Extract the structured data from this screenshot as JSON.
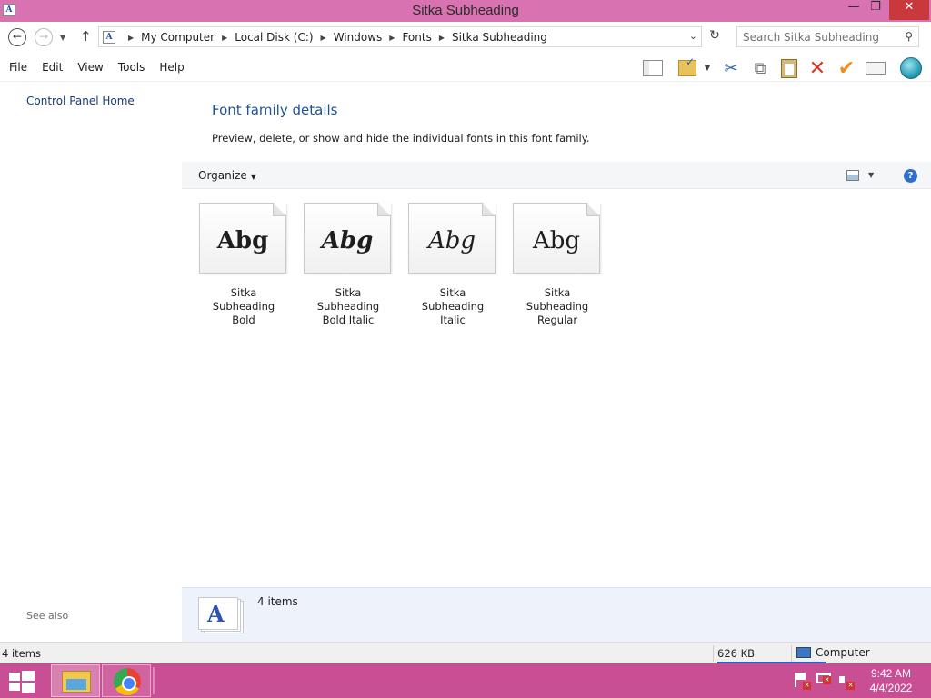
{
  "window": {
    "title": "Sitka Subheading",
    "minimize_glyph": "—",
    "maximize_glyph": "❐",
    "close_glyph": "✕"
  },
  "address": {
    "crumbs": [
      "My Computer",
      "Local Disk (C:)",
      "Windows",
      "Fonts",
      "Sitka Subheading"
    ],
    "search_placeholder": "Search Sitka Subheading"
  },
  "menu": {
    "items": [
      "File",
      "Edit",
      "View",
      "Tools",
      "Help"
    ]
  },
  "toolbar": {
    "icons": [
      "layout-icon",
      "folder-check-icon",
      "cut-icon",
      "copy-icon",
      "paste-icon",
      "delete-icon",
      "checkmark-icon",
      "properties-icon",
      "globe-icon"
    ]
  },
  "sidebar": {
    "home_link": "Control Panel Home",
    "see_also": "See also"
  },
  "main": {
    "title": "Font family details",
    "description": "Preview, delete, or show and hide the individual fonts in this font family.",
    "organize_label": "Organize",
    "fonts": [
      {
        "sample": "Abg",
        "style": "bold",
        "name_line1": "Sitka Subheading",
        "name_line2": "Bold"
      },
      {
        "sample": "Abg",
        "style": "bold-italic",
        "name_line1": "Sitka Subheading",
        "name_line2": "Bold Italic"
      },
      {
        "sample": "Abg",
        "style": "italic",
        "name_line1": "Sitka Subheading",
        "name_line2": "Italic"
      },
      {
        "sample": "Abg",
        "style": "regular",
        "name_line1": "Sitka Subheading",
        "name_line2": "Regular"
      }
    ]
  },
  "details": {
    "count": "4 items",
    "glyph": "A"
  },
  "status": {
    "items": "4 items",
    "size": "626 KB",
    "location": "Computer"
  },
  "taskbar": {
    "time": "9:42 AM",
    "date": "4/4/2022"
  },
  "colors": {
    "titlebar": "#d872b0",
    "taskbar": "#c94f95",
    "link": "#1a3c73",
    "heading": "#1d5295"
  }
}
